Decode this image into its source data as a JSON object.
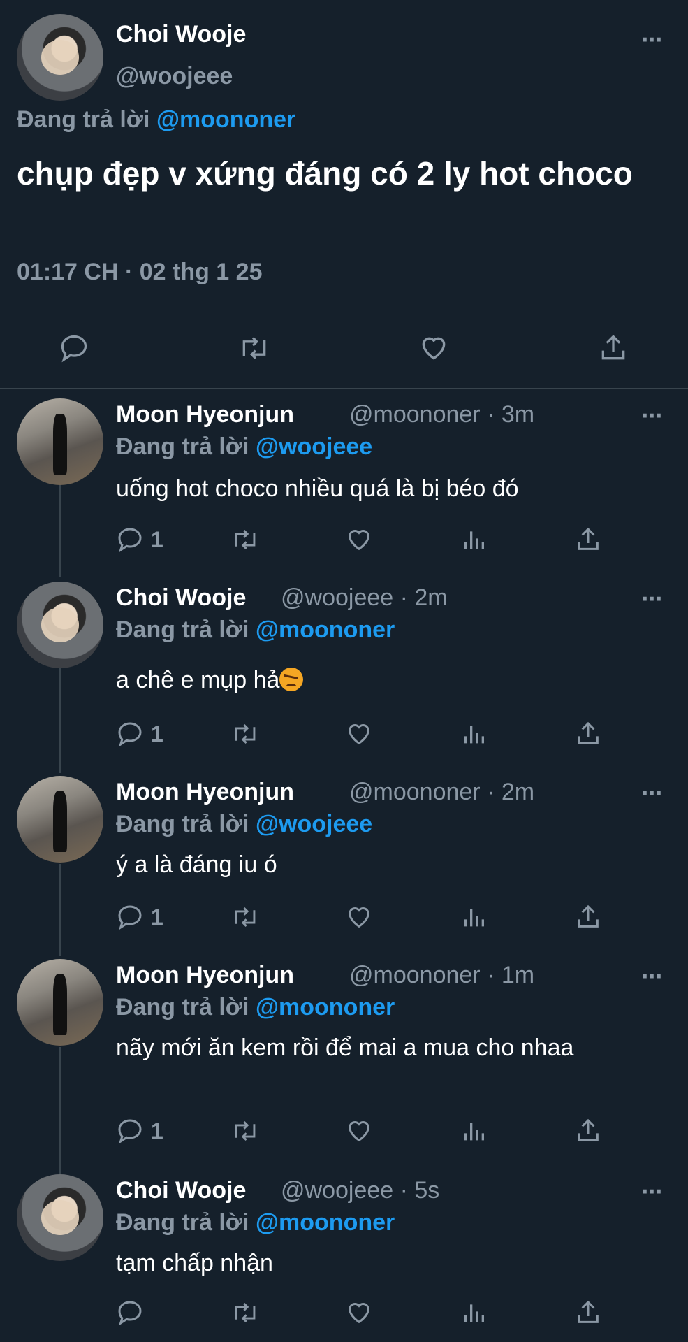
{
  "main_tweet": {
    "name": "Choi Wooje",
    "handle": "@woojeee",
    "replying_prefix": "Đang trả lời",
    "replying_to": "@moononer",
    "text": "chụp đẹp v xứng đáng có 2 ly hot choco",
    "timestamp": "01:17 CH · 02 thg 1 25",
    "more_icon": "⋯"
  },
  "replies": [
    {
      "name": "Moon Hyeonjun",
      "meta": "@moononer · 3m",
      "replying_prefix": "Đang trả lời",
      "replying_to": "@woojeee",
      "text": "uống hot choco nhiều quá là bị béo đó",
      "reply_count": "1"
    },
    {
      "name": "Choi Wooje",
      "meta": "@woojeee · 2m",
      "replying_prefix": "Đang trả lời",
      "replying_to": "@moononer",
      "text": "a chê e mụp hả",
      "reply_count": "1",
      "emoji": "angry-face"
    },
    {
      "name": "Moon Hyeonjun",
      "meta": "@moononer · 2m",
      "replying_prefix": "Đang trả lời",
      "replying_to": "@woojeee",
      "text": "ý a là đáng iu ó",
      "reply_count": "1"
    },
    {
      "name": "Moon Hyeonjun",
      "meta": "@moononer · 1m",
      "replying_prefix": "Đang trả lời",
      "replying_to": "@moononer",
      "text": "nãy mới ăn kem rồi để mai a mua cho nhaa",
      "reply_count": "1"
    },
    {
      "name": "Choi Wooje",
      "meta": "@woojeee · 5s",
      "replying_prefix": "Đang trả lời",
      "replying_to": "@moononer",
      "text": "tạm chấp nhận",
      "reply_count": ""
    }
  ],
  "colors": {
    "background": "#15202b",
    "muted": "#8b98a5",
    "link": "#1d9bf0",
    "divider": "#38444d"
  }
}
